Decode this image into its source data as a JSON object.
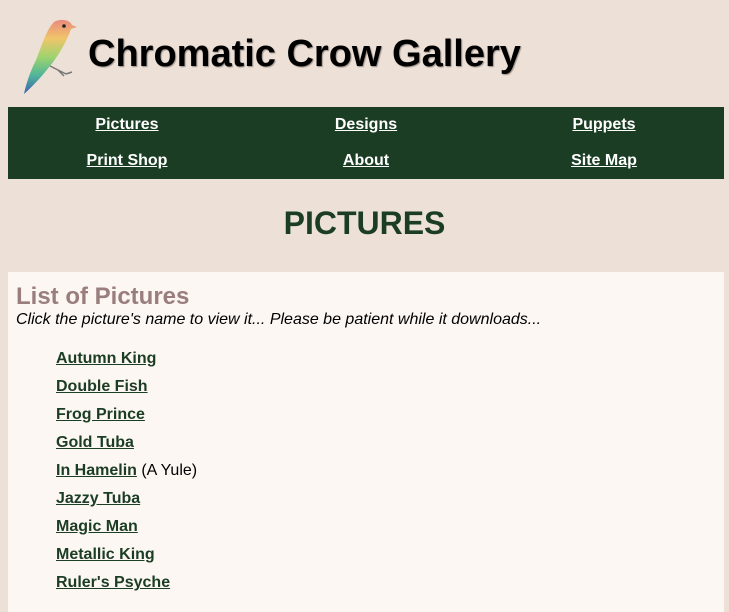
{
  "site": {
    "title": "Chromatic Crow Gallery"
  },
  "nav": {
    "items": [
      {
        "label": "Pictures"
      },
      {
        "label": "Designs"
      },
      {
        "label": "Puppets"
      },
      {
        "label": "Print Shop"
      },
      {
        "label": "About"
      },
      {
        "label": "Site Map"
      }
    ]
  },
  "page": {
    "heading": "PICTURES"
  },
  "list": {
    "title": "List of Pictures",
    "subtitle": "Click the picture's name to view it... Please be patient while it downloads...",
    "items": [
      {
        "name": "Autumn King",
        "note": ""
      },
      {
        "name": "Double Fish",
        "note": ""
      },
      {
        "name": "Frog Prince",
        "note": ""
      },
      {
        "name": "Gold Tuba",
        "note": ""
      },
      {
        "name": "In Hamelin",
        "note": " (A Yule)"
      },
      {
        "name": "Jazzy Tuba",
        "note": ""
      },
      {
        "name": "Magic Man",
        "note": ""
      },
      {
        "name": "Metallic King",
        "note": ""
      },
      {
        "name": "Ruler's Psyche",
        "note": ""
      }
    ]
  }
}
